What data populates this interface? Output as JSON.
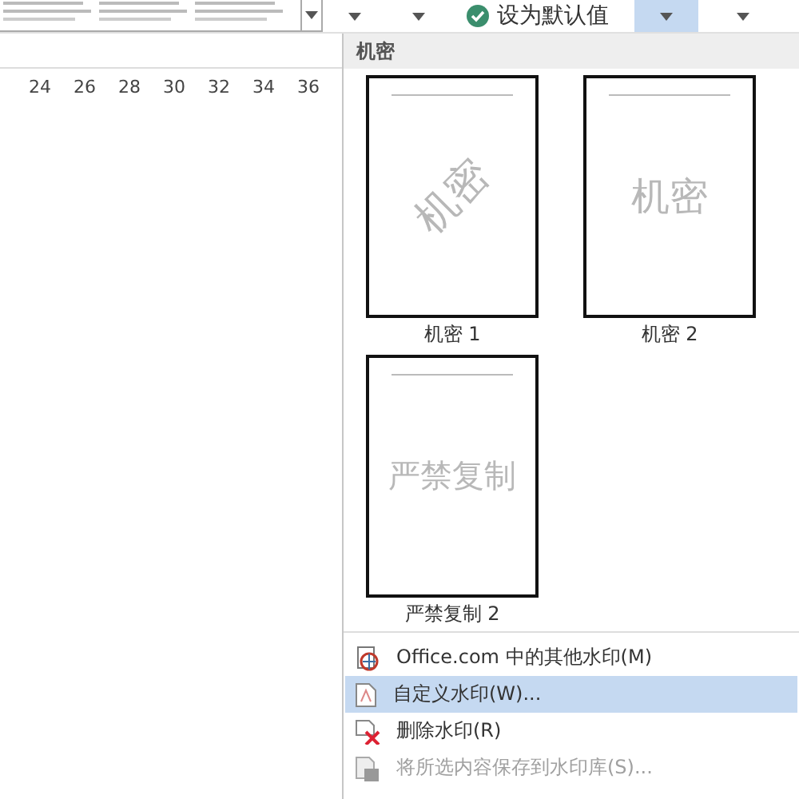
{
  "ribbon": {
    "set_default": "设为默认值",
    "dropdowns": [
      {
        "selected": false
      },
      {
        "selected": false
      },
      {
        "selected": true
      },
      {
        "selected": false
      }
    ]
  },
  "ruler": {
    "ticks": [
      "24",
      "26",
      "28",
      "30",
      "32",
      "34",
      "36"
    ]
  },
  "gallery": {
    "header": "机密",
    "items": [
      {
        "label": "机密 1",
        "watermark": "机密",
        "kind": "diagonal"
      },
      {
        "label": "机密 2",
        "watermark": "机密",
        "kind": "horizontal"
      },
      {
        "label": "严禁复制 2",
        "watermark": "严禁复制",
        "kind": "horizontal"
      }
    ]
  },
  "menu": [
    {
      "label": "Office.com 中的其他水印(M)",
      "kind": "globe",
      "selected": false,
      "disabled": false
    },
    {
      "label": "自定义水印(W)...",
      "kind": "page",
      "selected": true,
      "disabled": false
    },
    {
      "label": "删除水印(R)",
      "kind": "remove",
      "selected": false,
      "disabled": false
    },
    {
      "label": "将所选内容保存到水印库(S)...",
      "kind": "save",
      "selected": false,
      "disabled": true
    }
  ]
}
